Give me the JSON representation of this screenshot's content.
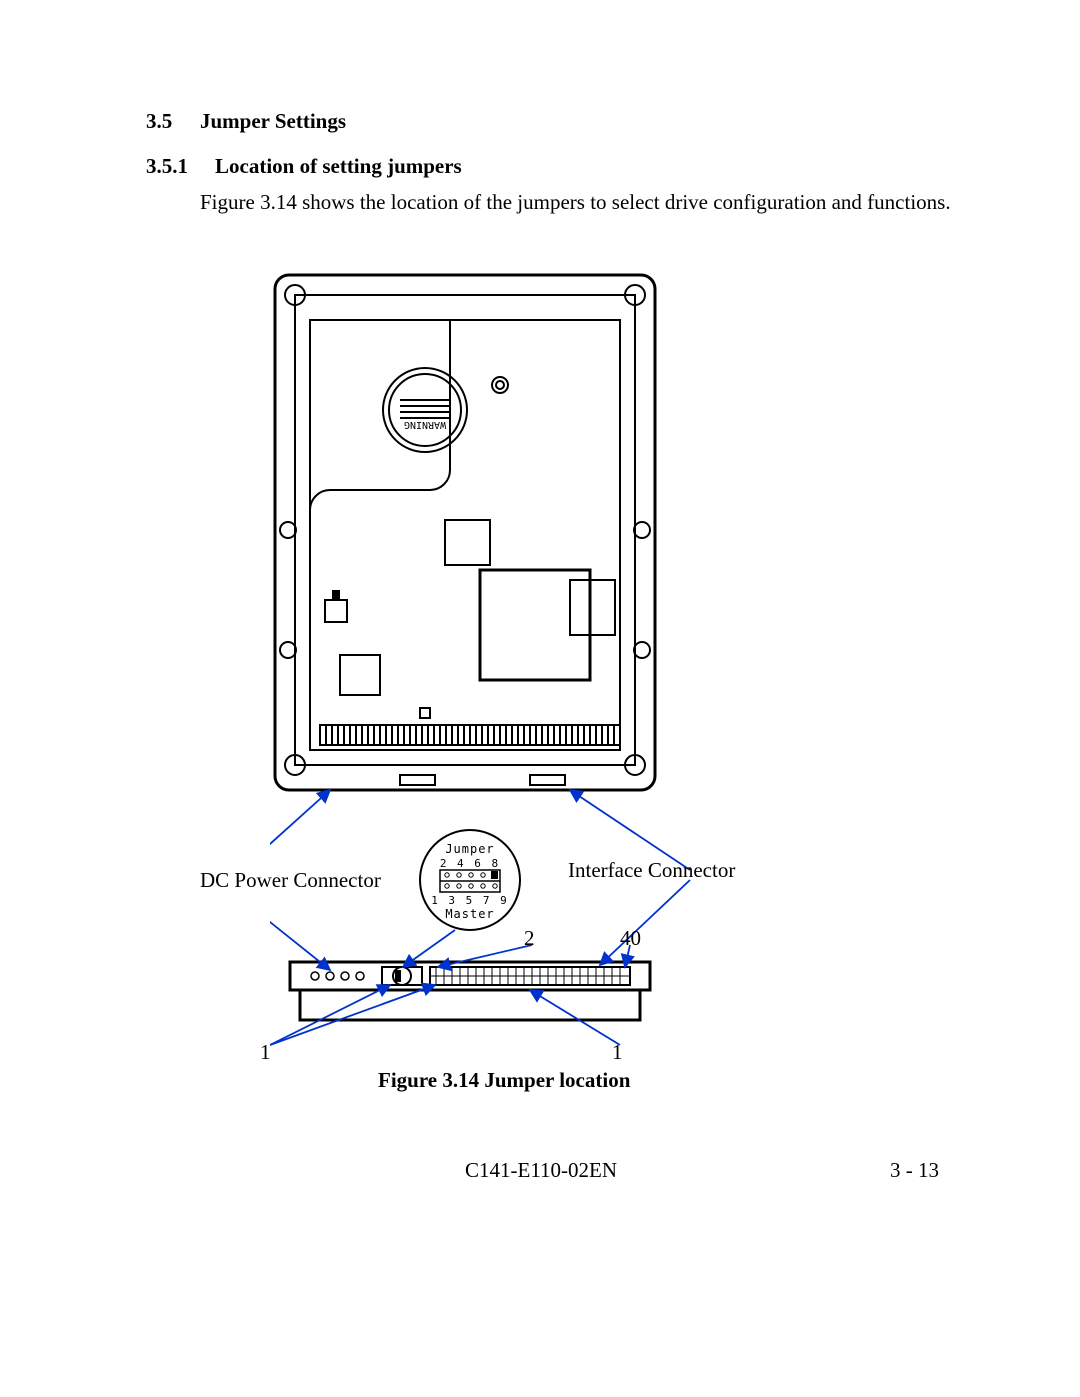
{
  "section": {
    "number": "3.5",
    "title": "Jumper Settings",
    "sub_number": "3.5.1",
    "sub_title": "Location of setting jumpers",
    "paragraph": "Figure 3.14 shows the location of the jumpers to select drive configuration and functions."
  },
  "figure": {
    "caption": "Figure 3.14   Jumper location",
    "labels": {
      "dc_power": "DC Power Connector",
      "interface": "Interface Connector",
      "two": "2",
      "forty": "40",
      "one_left": "1",
      "one_right": "1"
    },
    "callout": {
      "line1": "Jumper",
      "line2": "2 4 6 8",
      "line3": "1 3 5 7 9",
      "line4": "Master"
    },
    "drive_warning": "WARNING"
  },
  "footer": {
    "doc_id": "C141-E110-02EN",
    "page": "3 - 13"
  }
}
